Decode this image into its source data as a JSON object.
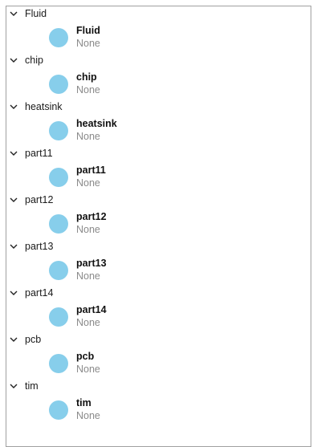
{
  "colors": {
    "dot": "#87ceeb",
    "subtitle": "#8a8a8a",
    "border": "#a0a0a0"
  },
  "tree": {
    "groups": [
      {
        "label": "Fluid",
        "item": {
          "title": "Fluid",
          "subtitle": "None"
        }
      },
      {
        "label": "chip",
        "item": {
          "title": "chip",
          "subtitle": "None"
        }
      },
      {
        "label": "heatsink",
        "item": {
          "title": "heatsink",
          "subtitle": "None"
        }
      },
      {
        "label": "part11",
        "item": {
          "title": "part11",
          "subtitle": "None"
        }
      },
      {
        "label": "part12",
        "item": {
          "title": "part12",
          "subtitle": "None"
        }
      },
      {
        "label": "part13",
        "item": {
          "title": "part13",
          "subtitle": "None"
        }
      },
      {
        "label": "part14",
        "item": {
          "title": "part14",
          "subtitle": "None"
        }
      },
      {
        "label": "pcb",
        "item": {
          "title": "pcb",
          "subtitle": "None"
        }
      },
      {
        "label": "tim",
        "item": {
          "title": "tim",
          "subtitle": "None"
        }
      }
    ]
  }
}
